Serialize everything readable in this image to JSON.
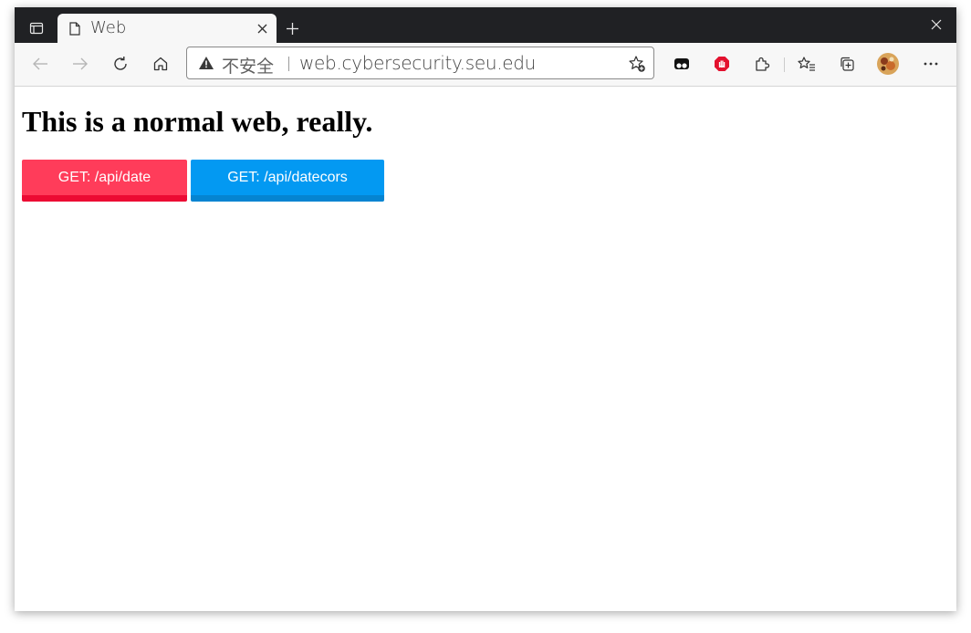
{
  "browser": {
    "tab": {
      "title": "Web"
    },
    "address_bar": {
      "security_text": "不安全",
      "url": "web.cybersecurity.seu.edu"
    },
    "icons": {
      "tab_actions": "tab-actions-icon",
      "page": "page-icon",
      "tab_close": "close-icon",
      "new_tab": "plus-icon",
      "window_close": "close-icon",
      "back": "back-arrow-icon",
      "forward": "forward-arrow-icon",
      "refresh": "refresh-icon",
      "home": "home-icon",
      "warning": "warning-icon",
      "add_favorite": "star-add-icon",
      "extension_1": "extension-icon",
      "extension_2": "adblock-icon",
      "extensions": "puzzle-icon",
      "favorites": "favorites-icon",
      "collections": "collections-icon",
      "profile": "avatar",
      "more": "more-icon"
    }
  },
  "page": {
    "heading": "This is a normal web, really.",
    "buttons": {
      "date_label": "GET: /api/date",
      "datecors_label": "GET: /api/datecors"
    }
  },
  "colors": {
    "titlebar": "#202124",
    "toolbar": "#f7f7f7",
    "btn_date": "#ff3c5a",
    "btn_date_border": "#ec0a33",
    "btn_cors": "#0399f2",
    "btn_cors_border": "#0584d1"
  }
}
